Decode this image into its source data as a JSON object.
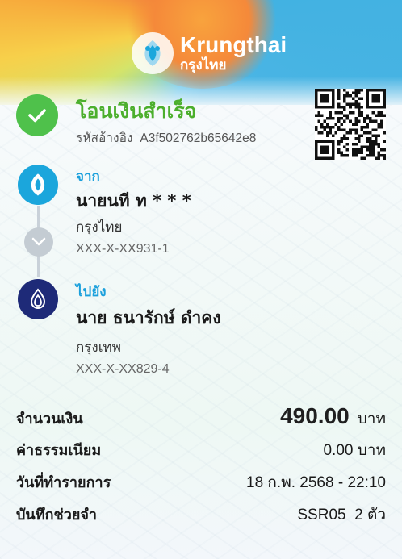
{
  "header": {
    "brand_en": "Krungthai",
    "brand_th": "กรุงไทย"
  },
  "status": {
    "title": "โอนเงินสำเร็จ",
    "ref_label": "รหัสอ้างอิง",
    "ref_code": "A3f502762b65642e8"
  },
  "from": {
    "label": "จาก",
    "name": "นายนที ท * * *",
    "bank": "กรุงไทย",
    "account": "XXX-X-XX931-1"
  },
  "to": {
    "label": "ไปยัง",
    "name": "นาย ธนารักษ์ ดำคง",
    "bank": "กรุงเทพ",
    "account": "XXX-X-XX829-4"
  },
  "details": {
    "amount_label": "จำนวนเงิน",
    "amount_value": "490.00",
    "amount_unit": "บาท",
    "fee_label": "ค่าธรรมเนียม",
    "fee_value": "0.00 บาท",
    "date_label": "วันที่ทำรายการ",
    "date_value": "18 ก.พ. 2568 - 22:10",
    "memo_label": "บันทึกช่วยจำ",
    "memo_value": "SSR05  2 ตัว"
  },
  "colors": {
    "success_green": "#4fc14b",
    "ktb_blue": "#1ba6dc",
    "bbl_navy": "#1e2a78"
  }
}
